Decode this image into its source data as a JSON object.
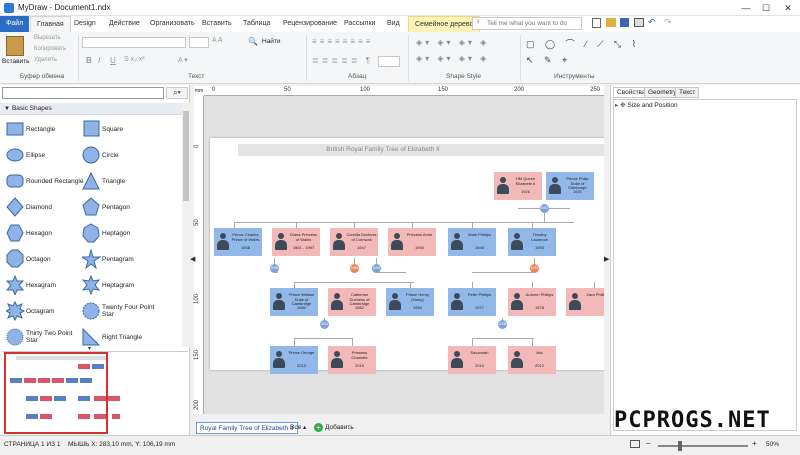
{
  "window": {
    "title": "MyDraw - Document1.ndx",
    "min": "—",
    "max": "☐",
    "close": "✕"
  },
  "tabs": [
    {
      "label": "Файл"
    },
    {
      "label": "Главная"
    },
    {
      "label": "Design"
    },
    {
      "label": "Действие"
    },
    {
      "label": "Организовать"
    },
    {
      "label": "Вставить"
    },
    {
      "label": "Таблица"
    },
    {
      "label": "Рецензирование"
    },
    {
      "label": "Рассылки"
    },
    {
      "label": "Вид"
    },
    {
      "label": "Семейное дерево"
    }
  ],
  "tellme": {
    "placeholder": "Tell me what you want to do"
  },
  "ribbon": {
    "paste": "Вставить",
    "cut": "Вырезать",
    "copy": "Копировать",
    "delete": "Удалить",
    "find": "Найти",
    "groups": {
      "clipboard": "Буфер обмена",
      "text": "Текст",
      "paragraph": "Абзац",
      "shape_style": "Shape Style",
      "tools": "Инструменты"
    }
  },
  "left_panel": {
    "category": "Basic Shapes",
    "shapes": [
      {
        "left": "Rectangle",
        "right": "Square"
      },
      {
        "left": "Ellipse",
        "right": "Circle"
      },
      {
        "left": "Rounded Rectangle",
        "right": "Triangle"
      },
      {
        "left": "Diamond",
        "right": "Pentagon"
      },
      {
        "left": "Hexagon",
        "right": "Heptagon"
      },
      {
        "left": "Octagon",
        "right": "Pentagram"
      },
      {
        "left": "Hexagram",
        "right": "Heptagram"
      },
      {
        "left": "Octagram",
        "right": "Twenty Four Point Star"
      },
      {
        "left": "Thirty Two Point Star",
        "right": "Right Triangle"
      }
    ]
  },
  "rulers": {
    "top": [
      "0",
      "50",
      "100",
      "150",
      "200",
      "250"
    ],
    "left": [
      "mm",
      "0",
      "50",
      "100",
      "150",
      "200",
      "250"
    ]
  },
  "diagram": {
    "title": "British Royal Family Tree of Elizabeth II",
    "people": [
      {
        "name": "HM Queen Elizabeth II",
        "year": "1926",
        "g": "f"
      },
      {
        "name": "Prince Philip Duke of Edinburgh",
        "year": "1921",
        "g": "m"
      },
      {
        "name": "Prince Charles Prince of Wales",
        "year": "1948",
        "g": "m"
      },
      {
        "name": "Diana Princess of Wales",
        "year": "1961 - 1997",
        "g": "f"
      },
      {
        "name": "Camilla Duchess of Cornwall",
        "year": "1947",
        "g": "f"
      },
      {
        "name": "Princess Anne",
        "year": "1950",
        "g": "f"
      },
      {
        "name": "Mark Phillips",
        "year": "1948",
        "g": "m"
      },
      {
        "name": "Timothy Laurence",
        "year": "1955",
        "g": "m"
      },
      {
        "name": "Prince William Duke of Cambridge",
        "year": "1982",
        "g": "m"
      },
      {
        "name": "Catherine Duchess of Cambridge",
        "year": "1982",
        "g": "f"
      },
      {
        "name": "Prince Henry (Harry)",
        "year": "1984",
        "g": "m"
      },
      {
        "name": "Peter Phillips",
        "year": "1977",
        "g": "m"
      },
      {
        "name": "Autumn Phillips",
        "year": "1978",
        "g": "f"
      },
      {
        "name": "Zara Phillips",
        "year": "",
        "g": "f"
      },
      {
        "name": "Prince George",
        "year": "2013",
        "g": "m"
      },
      {
        "name": "Princess Charlotte",
        "year": "2015",
        "g": "f"
      },
      {
        "name": "Savannah",
        "year": "2010",
        "g": "f"
      },
      {
        "name": "Isla",
        "year": "2012",
        "g": "f"
      }
    ],
    "marriages": [
      "1947",
      "2005",
      "1981",
      "1992",
      "1973",
      "2011",
      "2008"
    ]
  },
  "page_tabs": {
    "active": "Royal Family Tree of Elizabeth II",
    "all": "Все ▴",
    "add": "Добавить"
  },
  "right_panel": {
    "tabs": [
      "Свойства",
      "Geometry",
      "Текст"
    ],
    "section": "Size and Position"
  },
  "status": {
    "page": "СТРАНИЦА 1 ИЗ 1",
    "mouse": "МЫШЬ X: 283,10 mm, Y: 106,19 mm",
    "zoom": "50%"
  },
  "watermark": "PCPROGS.NET"
}
